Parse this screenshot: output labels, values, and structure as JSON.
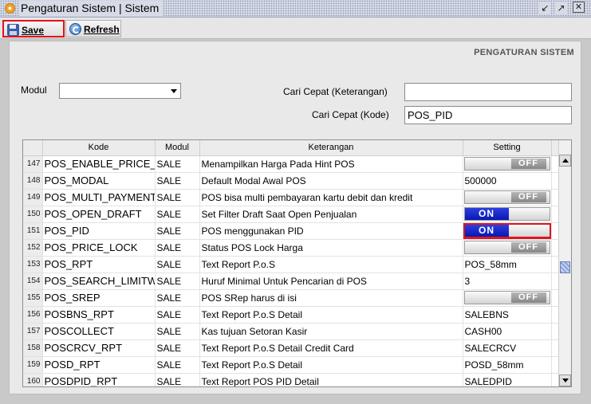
{
  "window": {
    "title": "Pengaturan Sistem | Sistem"
  },
  "toolbar": {
    "save_label": "Save",
    "refresh_label": "Refresh"
  },
  "panel": {
    "section_title": "PENGATURAN SISTEM",
    "modul_label": "Modul",
    "modul_value": "",
    "cari_keterangan_label": "Cari Cepat (Keterangan)",
    "cari_keterangan_value": "",
    "cari_kode_label": "Cari Cepat (Kode)",
    "cari_kode_value": "POS_PID"
  },
  "table": {
    "headers": {
      "kode": "Kode",
      "modul": "Modul",
      "keterangan": "Keterangan",
      "setting": "Setting"
    },
    "toggle_on_label": "ON",
    "toggle_off_label": "OFF",
    "rows": [
      {
        "num": "147",
        "kode": "POS_ENABLE_PRICE_",
        "modul": "SALE",
        "ket": "Menampilkan Harga Pada Hint POS",
        "type": "toggle",
        "value": "OFF"
      },
      {
        "num": "148",
        "kode": "POS_MODAL",
        "modul": "SALE",
        "ket": "Default Modal Awal POS",
        "type": "text",
        "value": "500000"
      },
      {
        "num": "149",
        "kode": "POS_MULTI_PAYMENT",
        "modul": "SALE",
        "ket": "POS bisa multi pembayaran kartu debit dan kredit",
        "type": "toggle",
        "value": "OFF"
      },
      {
        "num": "150",
        "kode": "POS_OPEN_DRAFT",
        "modul": "SALE",
        "ket": "Set Filter Draft Saat Open Penjualan",
        "type": "toggle",
        "value": "ON"
      },
      {
        "num": "151",
        "kode": "POS_PID",
        "modul": "SALE",
        "ket": "POS menggunakan PID",
        "type": "toggle",
        "value": "ON",
        "highlight": true
      },
      {
        "num": "152",
        "kode": "POS_PRICE_LOCK",
        "modul": "SALE",
        "ket": "Status POS Lock Harga",
        "type": "toggle",
        "value": "OFF"
      },
      {
        "num": "153",
        "kode": "POS_RPT",
        "modul": "SALE",
        "ket": "Text Report P.o.S",
        "type": "text",
        "value": "POS_58mm"
      },
      {
        "num": "154",
        "kode": "POS_SEARCH_LIMITW",
        "modul": "SALE",
        "ket": "Huruf Minimal Untuk Pencarian di POS",
        "type": "text",
        "value": "3"
      },
      {
        "num": "155",
        "kode": "POS_SREP",
        "modul": "SALE",
        "ket": "POS SRep harus di isi",
        "type": "toggle",
        "value": "OFF"
      },
      {
        "num": "156",
        "kode": "POSBNS_RPT",
        "modul": "SALE",
        "ket": "Text Report P.o.S Detail",
        "type": "text",
        "value": "SALEBNS"
      },
      {
        "num": "157",
        "kode": "POSCOLLECT",
        "modul": "SALE",
        "ket": "Kas tujuan Setoran Kasir",
        "type": "text",
        "value": "CASH00"
      },
      {
        "num": "158",
        "kode": "POSCRCV_RPT",
        "modul": "SALE",
        "ket": "Text Report P.o.S Detail Credit Card",
        "type": "text",
        "value": "SALECRCV"
      },
      {
        "num": "159",
        "kode": "POSD_RPT",
        "modul": "SALE",
        "ket": "Text Report P.o.S Detail",
        "type": "text",
        "value": "POSD_58mm"
      },
      {
        "num": "160",
        "kode": "POSDPID_RPT",
        "modul": "SALE",
        "ket": "Text Report POS PID Detail",
        "type": "text",
        "value": "SALEDPID"
      }
    ]
  }
}
